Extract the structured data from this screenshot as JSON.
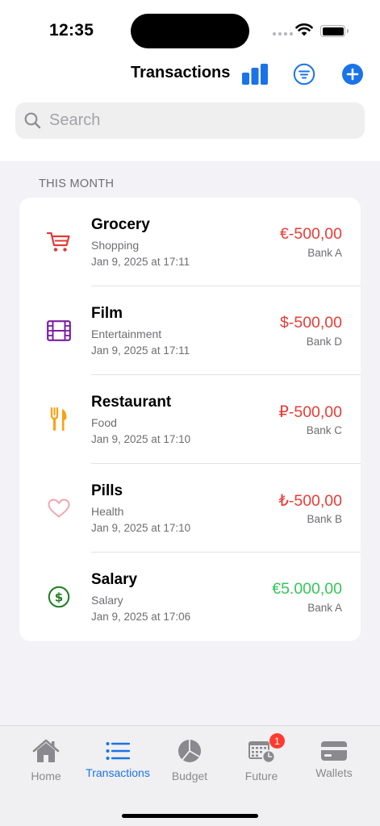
{
  "status_bar": {
    "time": "12:35"
  },
  "header": {
    "title": "Transactions"
  },
  "search": {
    "placeholder": "Search",
    "value": ""
  },
  "section": {
    "label": "THIS MONTH"
  },
  "transactions": [
    {
      "title": "Grocery",
      "category": "Shopping",
      "date": "Jan 9, 2025 at 17:11",
      "amount": "€-500,00",
      "bank": "Bank A",
      "icon": "cart-icon",
      "icon_color": "#e53935",
      "amount_color": "#eb3b35"
    },
    {
      "title": "Film",
      "category": "Entertainment",
      "date": "Jan 9, 2025 at 17:11",
      "amount": "$-500,00",
      "bank": "Bank D",
      "icon": "film-icon",
      "icon_color": "#7b1fa2",
      "amount_color": "#eb3b35"
    },
    {
      "title": "Restaurant",
      "category": "Food",
      "date": "Jan 9, 2025 at 17:10",
      "amount": "₽-500,00",
      "bank": "Bank C",
      "icon": "fork-knife-icon",
      "icon_color": "#ff9f0a",
      "amount_color": "#eb3b35"
    },
    {
      "title": "Pills",
      "category": "Health",
      "date": "Jan 9, 2025 at 17:10",
      "amount": "₺-500,00",
      "bank": "Bank B",
      "icon": "heart-icon",
      "icon_color": "#f5a3ab",
      "amount_color": "#eb3b35"
    },
    {
      "title": "Salary",
      "category": "Salary",
      "date": "Jan 9, 2025 at 17:06",
      "amount": "€5.000,00",
      "bank": "Bank A",
      "icon": "dollar-circle-icon",
      "icon_color": "#1b7f1e",
      "amount_color": "#34c759"
    }
  ],
  "tabbar": {
    "tabs": [
      {
        "label": "Home",
        "icon": "house-icon",
        "active": false
      },
      {
        "label": "Transactions",
        "icon": "list-icon",
        "active": true
      },
      {
        "label": "Budget",
        "icon": "pie-chart-icon",
        "active": false
      },
      {
        "label": "Future",
        "icon": "calendar-clock-icon",
        "active": false,
        "badge": "1"
      },
      {
        "label": "Wallets",
        "icon": "wallet-icon",
        "active": false
      }
    ]
  },
  "colors": {
    "accent": "#1a73e8",
    "expense": "#eb3b35",
    "income": "#34c759",
    "inactive": "#8a8a8e"
  }
}
